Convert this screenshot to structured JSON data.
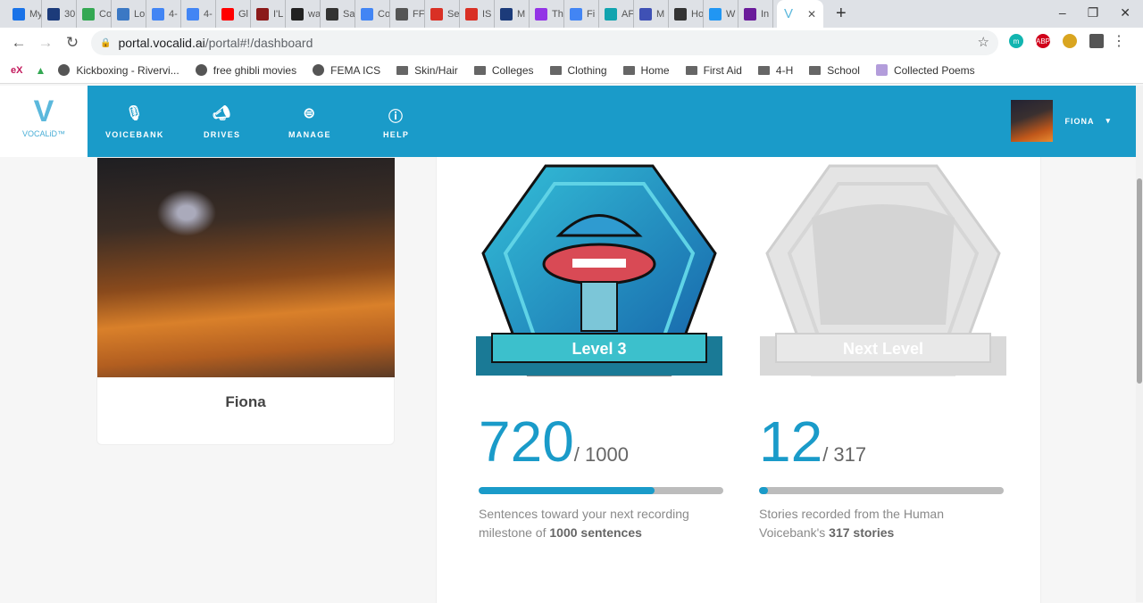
{
  "browser": {
    "tabs": [
      {
        "label": "My",
        "color": "#1a73e8"
      },
      {
        "label": "30",
        "color": "#1c3b7a"
      },
      {
        "label": "Co",
        "color": "#34a853"
      },
      {
        "label": "Lo",
        "color": "#3b78c4"
      },
      {
        "label": "4-",
        "color": "#4285f4"
      },
      {
        "label": "4-",
        "color": "#4285f4"
      },
      {
        "label": "Gl",
        "color": "#ff0000"
      },
      {
        "label": "I'L",
        "color": "#8b1a1a"
      },
      {
        "label": "wa",
        "color": "#222"
      },
      {
        "label": "Sa",
        "color": "#333"
      },
      {
        "label": "Co",
        "color": "#4285f4"
      },
      {
        "label": "FF",
        "color": "#555"
      },
      {
        "label": "Se",
        "color": "#d93025"
      },
      {
        "label": "IS",
        "color": "#d93025"
      },
      {
        "label": "M",
        "color": "#1c3b7a"
      },
      {
        "label": "Th",
        "color": "#9334e6"
      },
      {
        "label": "Fi",
        "color": "#4285f4"
      },
      {
        "label": "AF",
        "color": "#12a4af"
      },
      {
        "label": "M",
        "color": "#3f51b5"
      },
      {
        "label": "Ho",
        "color": "#333"
      },
      {
        "label": "W",
        "color": "#2196f3"
      },
      {
        "label": "In",
        "color": "#6a1b9a"
      }
    ],
    "active_tab": {
      "label": "V",
      "close": "✕"
    },
    "new_tab": "+",
    "url_host": "portal.vocalid.ai",
    "url_path": "/portal#!/dashboard",
    "bookmarks": [
      "Kickboxing - Rivervi...",
      "free ghibli movies",
      "FEMA ICS",
      "Skin/Hair",
      "Colleges",
      "Clothing",
      "Home",
      "First Aid",
      "4-H",
      "School",
      "Collected Poems"
    ]
  },
  "app": {
    "logo_text": "VOCALiD™",
    "nav": [
      {
        "label": "VOICEBANK",
        "icon": "microphone-icon"
      },
      {
        "label": "DRIVES",
        "icon": "megaphone-icon"
      },
      {
        "label": "MANAGE",
        "icon": "menu-icon"
      },
      {
        "label": "HELP",
        "icon": "help-icon"
      }
    ],
    "user": "FIONA",
    "profile_name": "Fiona",
    "badges": {
      "current": "Level 3",
      "next": "Next Level"
    },
    "sentences": {
      "count": "720",
      "total": "/ 1000",
      "progress": 0.72,
      "desc": "Sentences toward your next recording milestone of ",
      "desc_bold": "1000 sentences"
    },
    "stories": {
      "count": "12",
      "total": "/ 317",
      "progress": 0.038,
      "desc": "Stories recorded from the Human Voicebank's ",
      "desc_bold": "317 stories"
    },
    "colors": {
      "brand": "#1a9bc9"
    }
  }
}
